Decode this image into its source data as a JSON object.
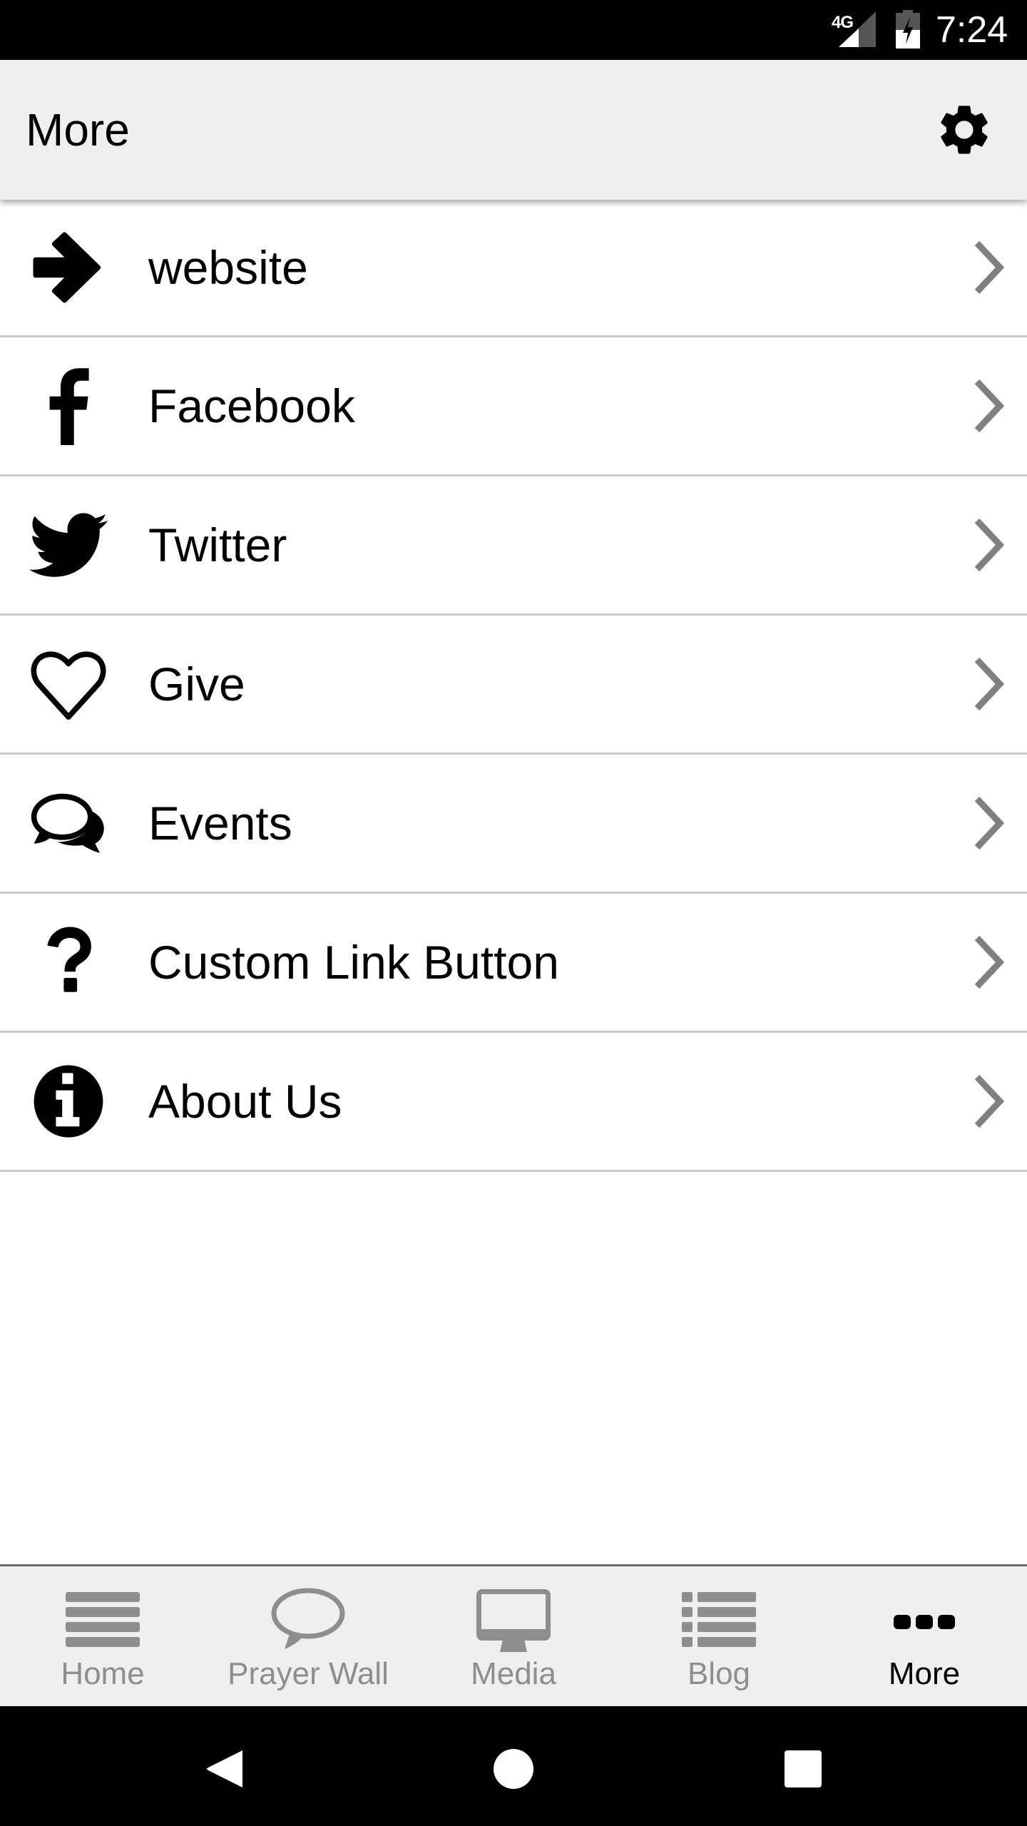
{
  "status_bar": {
    "network": "4G",
    "time": "7:24",
    "icons": [
      "signal-icon",
      "battery-charging-icon"
    ]
  },
  "toolbar": {
    "title": "More",
    "settings_icon": "gear-icon"
  },
  "menu": {
    "items": [
      {
        "label": "website",
        "icon": "arrow-right-icon"
      },
      {
        "label": "Facebook",
        "icon": "facebook-icon"
      },
      {
        "label": "Twitter",
        "icon": "twitter-icon"
      },
      {
        "label": "Give",
        "icon": "heart-icon"
      },
      {
        "label": "Events",
        "icon": "chat-bubbles-icon"
      },
      {
        "label": "Custom Link Button",
        "icon": "question-mark-icon"
      },
      {
        "label": "About Us",
        "icon": "info-icon"
      }
    ],
    "chevron_icon": "chevron-right-icon"
  },
  "bottom_nav": {
    "tabs": [
      {
        "label": "Home",
        "icon": "home-lines-icon",
        "active": false
      },
      {
        "label": "Prayer Wall",
        "icon": "speech-bubble-icon",
        "active": false
      },
      {
        "label": "Media",
        "icon": "monitor-icon",
        "active": false
      },
      {
        "label": "Blog",
        "icon": "list-icon",
        "active": false
      },
      {
        "label": "More",
        "icon": "more-dots-icon",
        "active": true
      }
    ]
  },
  "system_nav": {
    "buttons": [
      "back",
      "home",
      "recents"
    ]
  },
  "colors": {
    "toolbar_bg": "#efefef",
    "divider": "#cccccc",
    "tab_inactive": "#8e8e8e",
    "tab_active": "#000000",
    "chevron": "#808080"
  }
}
